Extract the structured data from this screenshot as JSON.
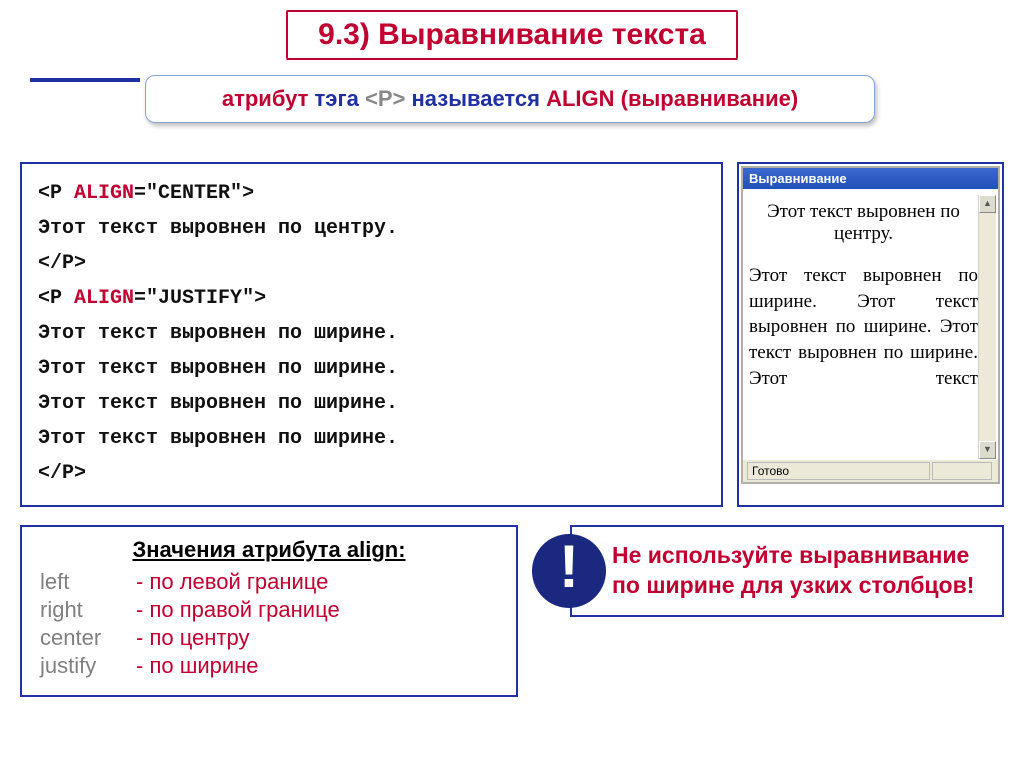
{
  "title": "9.3) Выравнивание текста",
  "subtitle": {
    "part1": "атрибут",
    "part2": "тэга",
    "part3": "<P>",
    "part4": "называется",
    "part5": "ALIGN (выравнивание)"
  },
  "code": {
    "line1_open": "<P ",
    "line1_attr": "ALIGN",
    "line1_eq": "=",
    "line1_val": "\"CENTER\"",
    "line1_close": ">",
    "line2": "Этот текст выровнен по центру.",
    "line3": "</P>",
    "line4_open": "<P ",
    "line4_attr": "ALIGN",
    "line4_eq": "=",
    "line4_val": "\"JUSTIFY\"",
    "line4_close": ">",
    "line5": "Этот текст выровнен по ширине.",
    "line6": "Этот текст выровнен по ширине.",
    "line7": "Этот текст выровнен по ширине.",
    "line8": "Этот текст выровнен по ширине.",
    "line9": "</P>"
  },
  "browser": {
    "title": "Выравнивание",
    "centered": "Этот текст выровнен по центру.",
    "justified": "Этот текст выровнен по ширине. Этот текст выровнен по ширине. Этот текст выровнен по ширине. Этот текст",
    "status": "Готово",
    "up": "▲",
    "down": "▼"
  },
  "values": {
    "title": "Значения атрибута align:",
    "rows": [
      {
        "key": "left",
        "desc": "-  по левой границе"
      },
      {
        "key": "right",
        "desc": "-  по правой границе"
      },
      {
        "key": "center",
        "desc": "-  по центру"
      },
      {
        "key": "justify",
        "desc": "-  по ширине"
      }
    ]
  },
  "warning": {
    "mark": "!",
    "text": "Не используйте выравнивание по ширине для узких столбцов!"
  }
}
